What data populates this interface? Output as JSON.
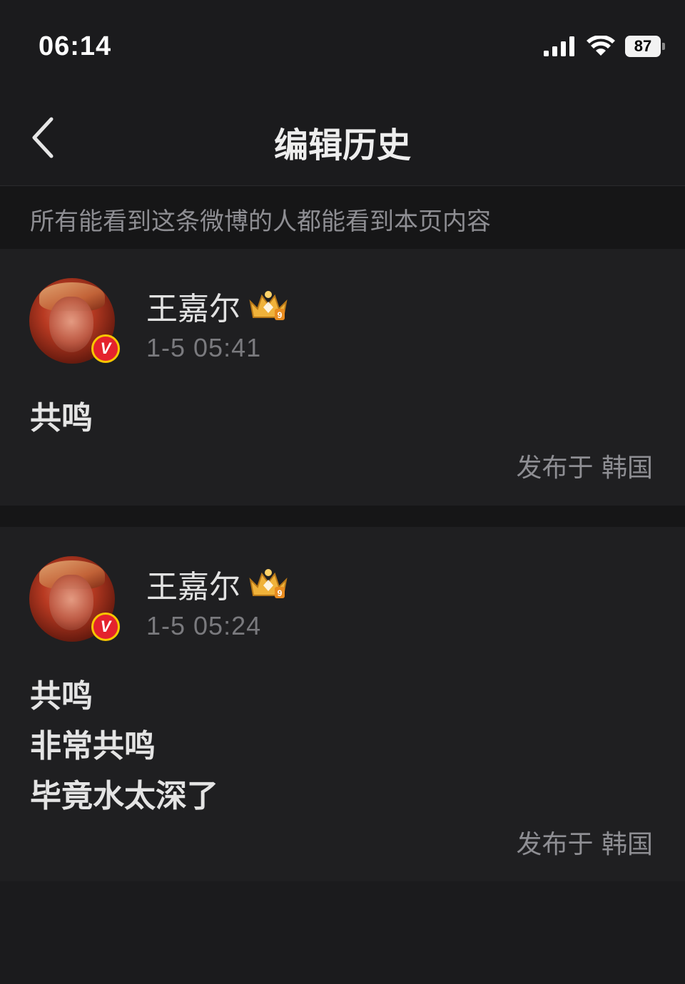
{
  "status_bar": {
    "time": "06:14",
    "battery": "87",
    "signal_icon": "cellular-signal-icon",
    "wifi_icon": "wifi-icon"
  },
  "nav": {
    "title": "编辑历史",
    "back_icon": "chevron-left-icon"
  },
  "notice": "所有能看到这条微博的人都能看到本页内容",
  "versions": [
    {
      "username": "王嘉尔",
      "timestamp": "1-5 05:41",
      "lines": [
        "共鸣"
      ],
      "location": "发布于 韩国"
    },
    {
      "username": "王嘉尔",
      "timestamp": "1-5 05:24",
      "lines": [
        "共鸣",
        "非常共鸣",
        "毕竟水太深了"
      ],
      "location": "发布于 韩国"
    }
  ],
  "colors": {
    "background": "#1b1b1d",
    "card": "#1f1f21",
    "band": "#161617",
    "verified_badge": "#e4222d",
    "badge_ring": "#f7c600",
    "vip_crown": "#f0b23a"
  },
  "badges": {
    "verified": "V",
    "vip_level": "9"
  }
}
